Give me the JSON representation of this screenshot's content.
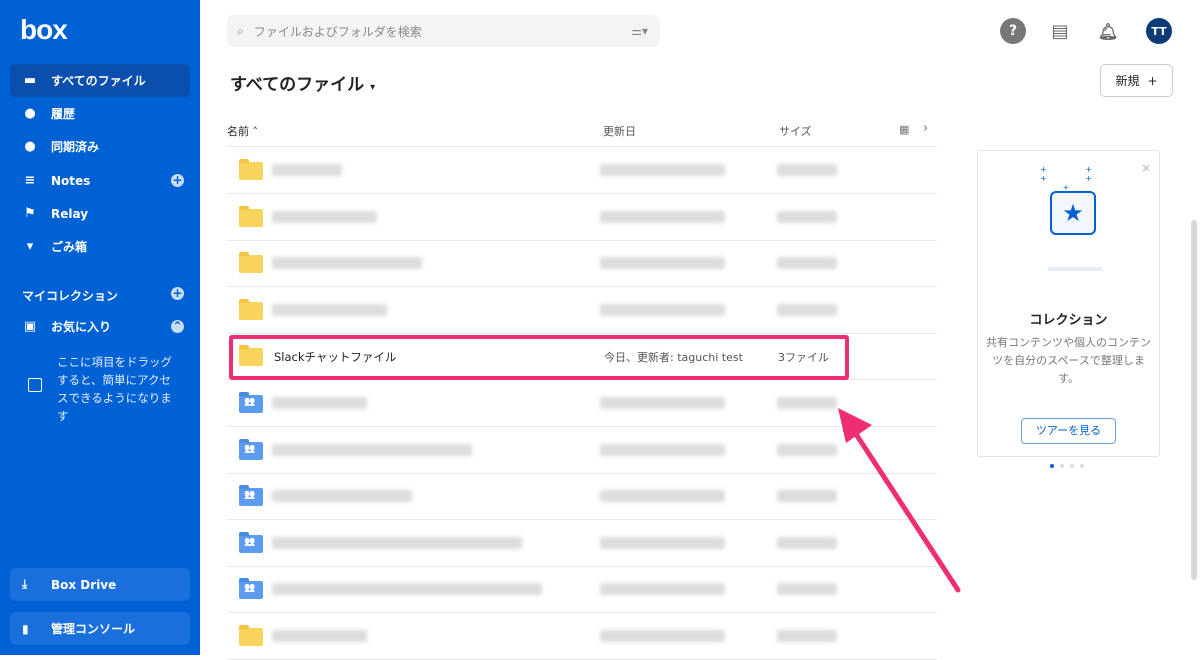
{
  "sidebar": {
    "logo": "box",
    "items": [
      {
        "label": "すべてのファイル",
        "icon": "folder-icon"
      },
      {
        "label": "履歴",
        "icon": "clock-icon"
      },
      {
        "label": "同期済み",
        "icon": "check-circle-icon"
      },
      {
        "label": "Notes",
        "icon": "notes-icon"
      },
      {
        "label": "Relay",
        "icon": "relay-icon"
      },
      {
        "label": "ごみ箱",
        "icon": "trash-icon"
      }
    ],
    "collections_heading": "マイコレクション",
    "favorites": "お気に入り",
    "hint": "ここに項目をドラッグすると、簡単にアクセスできるようになります",
    "box_drive": "Box Drive",
    "admin_console": "管理コンソール"
  },
  "header": {
    "search_placeholder": "ファイルおよびフォルダを検索",
    "avatar": "TT",
    "help": "?"
  },
  "main": {
    "title": "すべてのファイル",
    "new_button": "新規",
    "columns": {
      "name": "名前",
      "updated": "更新日",
      "size": "サイズ"
    },
    "highlighted_row": {
      "name": "Slackチャットファイル",
      "updated": "今日、更新者: taguchi test",
      "size": "3ファイル"
    }
  },
  "card": {
    "title": "コレクション",
    "description": "共有コンテンツや個人のコンテンツを自分のスペースで整理します。",
    "button": "ツアーを見る",
    "close": "×"
  },
  "colors": {
    "brand": "#0061d5",
    "highlight": "#ef2d72"
  }
}
